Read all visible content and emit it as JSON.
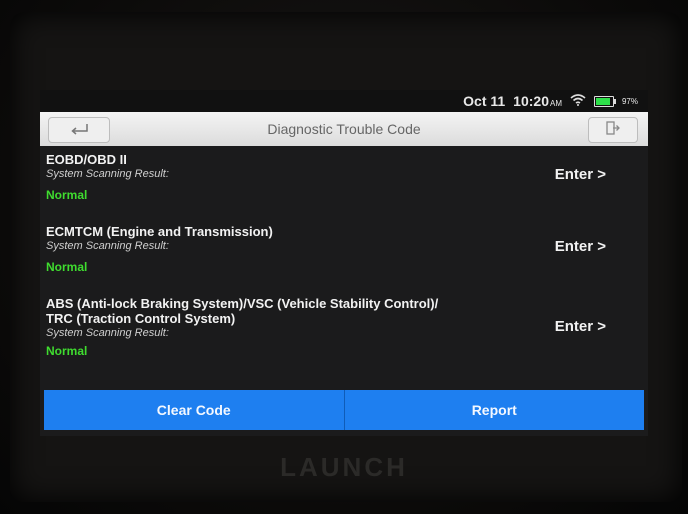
{
  "statusbar": {
    "date": "Oct 11",
    "time": "10:20",
    "time_suffix": "AM",
    "battery": "97%",
    "battery_level": 0.97
  },
  "titlebar": {
    "title": "Diagnostic Trouble Code"
  },
  "systems": [
    {
      "name_line1": "EOBD/OBD II",
      "name_line2": "",
      "subtitle": "System Scanning Result:",
      "status": "Normal",
      "enter_label": "Enter >"
    },
    {
      "name_line1": "ECMTCM (Engine and Transmission)",
      "name_line2": "",
      "subtitle": "System Scanning Result:",
      "status": "Normal",
      "enter_label": "Enter >"
    },
    {
      "name_line1": "ABS (Anti-lock Braking System)/VSC (Vehicle Stability Control)/",
      "name_line2": "TRC (Traction Control System)",
      "subtitle": "System Scanning Result:",
      "status": "Normal",
      "enter_label": "Enter >"
    }
  ],
  "actions": {
    "clear_code": "Clear Code",
    "report": "Report"
  },
  "brand": "LAUNCH",
  "colors": {
    "accent": "#1e7ff0",
    "status_ok": "#3fdc2f"
  },
  "icons": {
    "back": "back-arrow-icon",
    "exit": "exit-icon",
    "wifi": "wifi-icon",
    "battery": "battery-icon"
  }
}
